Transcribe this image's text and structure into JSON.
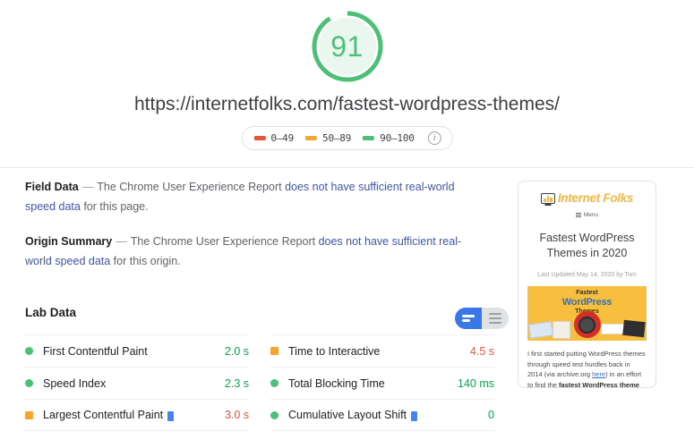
{
  "score": {
    "value": "91",
    "color": "#4cc076",
    "track_color": "#e9f7ef",
    "percent": 91
  },
  "url": "https://internetfolks.com/fastest-wordpress-themes/",
  "legend": {
    "items": [
      {
        "range": "0–49",
        "color": "#e8553b",
        "icon": "triangle-swatch"
      },
      {
        "range": "50–89",
        "color": "#f5a436",
        "icon": "square-swatch"
      },
      {
        "range": "90–100",
        "color": "#4cc076",
        "icon": "circle-swatch"
      }
    ],
    "info_icon": "info-icon",
    "info_glyph": "i"
  },
  "field_data": {
    "title": "Field Data",
    "dash": "—",
    "text_before": "The Chrome User Experience Report ",
    "link_text": "does not have sufficient real-world speed data",
    "text_after": " for this page."
  },
  "origin_summary": {
    "title": "Origin Summary",
    "dash": "—",
    "text_before": "The Chrome User Experience Report ",
    "link_text": "does not have sufficient real-world speed data",
    "text_after": " for this origin."
  },
  "lab_data": {
    "heading": "Lab Data",
    "view_toggle": {
      "left_label": "expanded-view",
      "right_label": "compact-view",
      "active": "left",
      "active_color": "#3b78e7",
      "inactive_color": "#e0e2e4"
    },
    "columns": [
      {
        "metrics": [
          {
            "status": "pass",
            "name": "First Contentful Paint",
            "value": "2.0 s",
            "value_class": "good",
            "badge": false
          },
          {
            "status": "pass",
            "name": "Speed Index",
            "value": "2.3 s",
            "value_class": "good",
            "badge": false
          },
          {
            "status": "avg",
            "name": "Largest Contentful Paint",
            "value": "3.0 s",
            "value_class": "bad",
            "badge": true
          }
        ]
      },
      {
        "metrics": [
          {
            "status": "avg",
            "name": "Time to Interactive",
            "value": "4.5 s",
            "value_class": "bad",
            "badge": false
          },
          {
            "status": "pass",
            "name": "Total Blocking Time",
            "value": "140 ms",
            "value_class": "good",
            "badge": false
          },
          {
            "status": "pass",
            "name": "Cumulative Layout Shift",
            "value": "0",
            "value_class": "good",
            "badge": true
          }
        ]
      }
    ]
  },
  "thumbnail": {
    "logo_text": "Internet Folks",
    "logo_icon": "monitor-chart-icon",
    "menu_label": "Menu",
    "menu_icon": "hamburger-icon",
    "page_title": "Fastest WordPress Themes in 2020",
    "meta": "Last Updated May 14, 2020 by Tom",
    "feature": {
      "line1": "Fastest",
      "line2": "WordPress",
      "line3": "Themes"
    },
    "body_before": "I first started putting WordPress themes through speed test hurdles back in 2014 (via archive.org ",
    "body_link": "here",
    "body_mid": ") in an effort to find the ",
    "body_bold": "fastest WordPress theme"
  }
}
